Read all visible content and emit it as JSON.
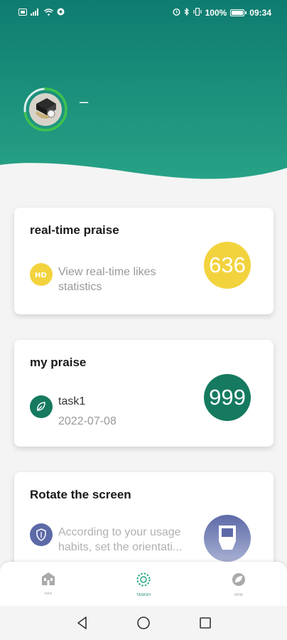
{
  "status_bar": {
    "left_icons": [
      "sim-icon",
      "signal-icon",
      "wifi-icon",
      "vpn-icon"
    ],
    "right_icons": [
      "alarm-icon",
      "bluetooth-icon",
      "vibrate-icon"
    ],
    "battery": "100%",
    "time": "09:34"
  },
  "profile": {
    "name": "–",
    "ring_progress": 0.72
  },
  "cards": {
    "realtime": {
      "title": "real-time praise",
      "text_line1": "View real-time likes",
      "text_line2": "statistics",
      "count": "636"
    },
    "mypraise": {
      "title": "my praise",
      "task": "task1",
      "date": "2022-07-08",
      "count": "999"
    },
    "rotate": {
      "title": "Rotate the screen",
      "text_line1": "According to your usage",
      "text_line2": "habits, set the orientati..."
    }
  },
  "bottom_nav": {
    "items": [
      {
        "icon": "building-icon",
        "label": "mine",
        "active": false
      },
      {
        "icon": "ring-icon",
        "label": "TASKSH",
        "active": true
      },
      {
        "icon": "leaf-icon",
        "label": "MINE",
        "active": false
      }
    ]
  },
  "system_nav": [
    "back-icon",
    "home-icon",
    "recents-icon"
  ],
  "colors": {
    "teal_dark": "#0e7f6e",
    "teal_light": "#2aa588",
    "yellow": "#f2d33e",
    "green": "#157a5f",
    "rotate_blue": "#5d6aa8"
  }
}
